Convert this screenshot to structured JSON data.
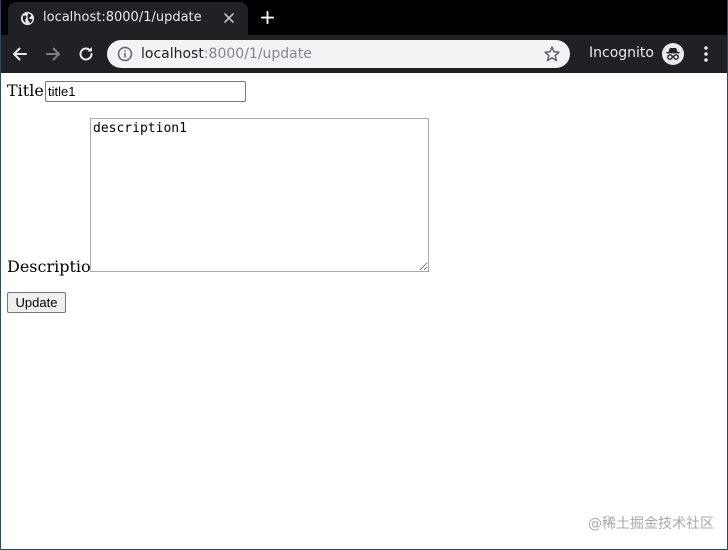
{
  "browser": {
    "tab": {
      "title": "localhost:8000/1/update",
      "favicon_icon": "globe-icon",
      "close_icon": "close-icon"
    },
    "new_tab_icon": "plus-icon",
    "nav": {
      "back_icon": "arrow-left-icon",
      "forward_icon": "arrow-right-icon",
      "reload_icon": "reload-icon"
    },
    "omnibox": {
      "info_icon": "info-icon",
      "url_host": "localhost",
      "url_path": ":8000/1/update",
      "bookmark_icon": "star-icon"
    },
    "profile": {
      "label": "Incognito",
      "icon": "incognito-icon"
    },
    "menu_icon": "kebab-menu-icon"
  },
  "form": {
    "title_label": "Title:",
    "title_value": "title1",
    "description_label": "Description:",
    "description_value": "description1",
    "submit_label": "Update"
  },
  "watermark": "@稀土掘金技术社区",
  "colors": {
    "tabstrip_bg": "#000000",
    "toolbar_bg": "#202124",
    "omnibox_bg": "#f1f3f4",
    "page_bg": "#ffffff"
  }
}
